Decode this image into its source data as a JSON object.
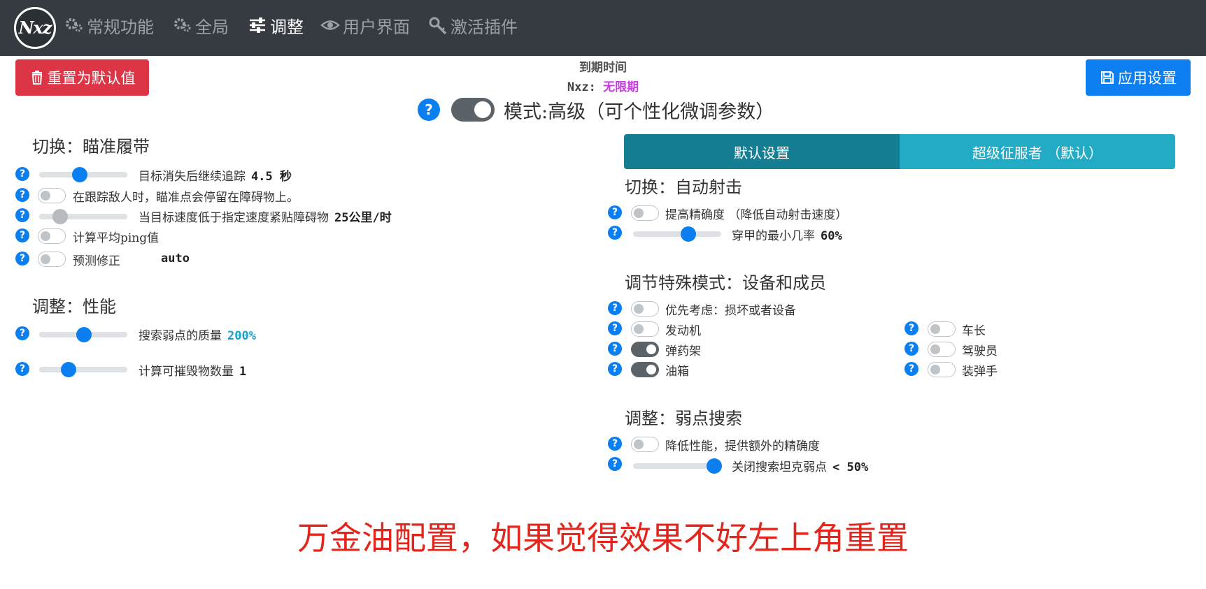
{
  "nav": {
    "logo": "Nxz",
    "items": [
      {
        "label": "常规功能",
        "icon": "gears-icon"
      },
      {
        "label": "全局",
        "icon": "gears-icon"
      },
      {
        "label": "调整",
        "icon": "sliders-icon",
        "active": true
      },
      {
        "label": "用户界面",
        "icon": "eye-icon"
      },
      {
        "label": "激活插件",
        "icon": "key-icon"
      }
    ]
  },
  "toolbar": {
    "reset_label": "重置为默认值",
    "apply_label": "应用设置",
    "expiry_label": "到期时间",
    "expiry_user": "Nxz:",
    "expiry_value": "无限期"
  },
  "mode": {
    "label": "模式:高级（可个性化微调参数）",
    "enabled": true
  },
  "left": {
    "tracks": {
      "title": "切换：瞄准履带",
      "rows": [
        {
          "type": "slider",
          "label": "目标消失后继续追踪",
          "value": "4.5 秒",
          "fill": 0.42
        },
        {
          "type": "switch",
          "label": "在跟踪敌人时，瞄准点会停留在障碍物上。",
          "on": false
        },
        {
          "type": "slider",
          "label": "当目标速度低于指定速度紧贴障碍物",
          "value": "25公里/时",
          "fill": 0.24,
          "disabled": true
        },
        {
          "type": "switch",
          "label": "计算平均ping值",
          "on": false
        },
        {
          "type": "switch",
          "label": "预测修正",
          "value": "auto",
          "on": false
        }
      ]
    },
    "performance": {
      "title": "调整：性能",
      "rows": [
        {
          "type": "slider",
          "label": "搜索弱点的质量",
          "value": "200%",
          "fill": 0.5
        },
        {
          "type": "slider",
          "label": "计算可摧毁物数量",
          "value": "1",
          "fill": 0.33
        }
      ]
    }
  },
  "right": {
    "tabs": [
      {
        "label": "默认设置",
        "active": true
      },
      {
        "label": "超级征服者 （默认）",
        "active": false
      }
    ],
    "autofire": {
      "title": "切换：自动射击",
      "rows": [
        {
          "type": "switch",
          "label": "提高精确度 （降低自动射击速度）",
          "on": false
        },
        {
          "type": "slider",
          "label": "穿甲的最小几率",
          "value": "60%",
          "fill": 0.63
        }
      ]
    },
    "special": {
      "title": "调节特殊模式：设备和成员",
      "priority": {
        "label": "优先考虑：损坏或者设备",
        "on": false
      },
      "col1": [
        {
          "label": "发动机",
          "on": false
        },
        {
          "label": "弹药架",
          "on": true
        },
        {
          "label": "油箱",
          "on": true
        }
      ],
      "col2": [
        {
          "label": "车长",
          "on": false
        },
        {
          "label": "驾驶员",
          "on": false
        },
        {
          "label": "装弹手",
          "on": false
        }
      ]
    },
    "weakspot": {
      "title": "调整：弱点搜索",
      "rows": [
        {
          "type": "switch",
          "label": "降低性能，提供额外的精确度",
          "on": false
        },
        {
          "type": "slider",
          "label": "关闭搜索坦克弱点",
          "value": "< 50%",
          "fill": 0.92
        }
      ]
    }
  },
  "caption": "万金油配置，如果觉得效果不好左上角重置",
  "colors": {
    "nav_bg": "#353b41",
    "primary": "#0b7ff0",
    "danger": "#dc3545",
    "tab_active": "#157e92",
    "tab": "#23aac4",
    "caption": "#e3261d"
  }
}
